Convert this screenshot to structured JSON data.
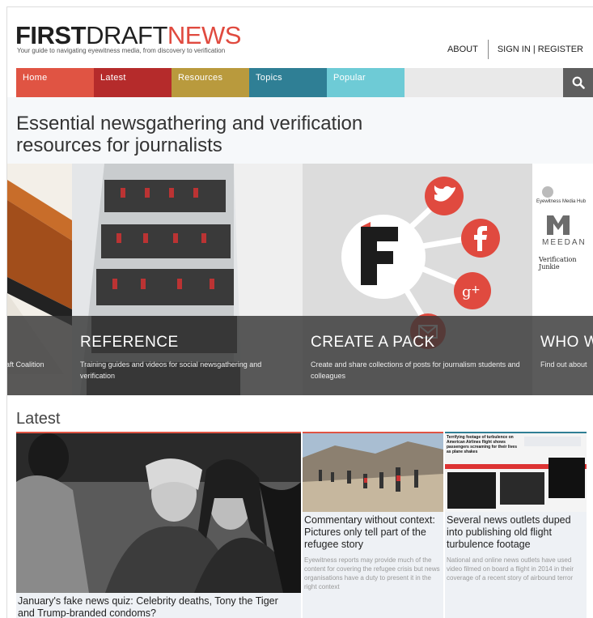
{
  "site": {
    "logo_part1": "FIRST",
    "logo_part2": "DRAFT",
    "logo_part3": "NEWS",
    "tagline": "Your guide to navigating eyewitness media, from discovery to verification"
  },
  "top_nav": {
    "about": "ABOUT",
    "signin": "SIGN IN | REGISTER"
  },
  "main_nav": {
    "items": [
      {
        "label": "Home",
        "color": "#e05443"
      },
      {
        "label": "Latest",
        "color": "#b52b2b"
      },
      {
        "label": "Resources",
        "color": "#b99a3d"
      },
      {
        "label": "Topics",
        "color": "#2f7f95"
      },
      {
        "label": "Popular",
        "color": "#6ecbd6"
      }
    ],
    "search_icon": "search-icon"
  },
  "hero": {
    "title_line1": "Essential newsgathering and verification",
    "title_line2": "resources for journalists"
  },
  "carousel": {
    "left_partial": {
      "title": "",
      "desc": "aft Coalition"
    },
    "slides": [
      {
        "title": "REFERENCE",
        "desc": "Training guides and videos for social newsgathering and verification"
      },
      {
        "title": "CREATE A PACK",
        "desc": "Create and share collections of posts for journalism students and colleagues"
      },
      {
        "title": "WHO W",
        "desc": "Find out about"
      }
    ],
    "partner_logos": [
      "Eyewitness Media Hub",
      "MEEDAN",
      "Verification Junkie"
    ],
    "social_icons": [
      "twitter-icon",
      "facebook-icon",
      "google-plus-icon",
      "mail-icon"
    ]
  },
  "latest": {
    "heading": "Latest",
    "cards": [
      {
        "title": "January's fake news quiz: Celebrity deaths, Tony the Tiger and Trump-branded condoms?",
        "desc": "",
        "border": "#e05443"
      },
      {
        "title": "Commentary without context: Pictures only tell part of the refugee story",
        "desc": "Eyewitness reports may provide much of the content for covering the refugee crisis but news organisations have a duty to present it in the right context",
        "border": "#e05443"
      },
      {
        "title": "Several news outlets duped into publishing old flight turbulence footage",
        "desc": "National and online news outlets have used video filmed on board a flight in 2014 in their coverage of a recent story of airbound terror",
        "border": "#2f7f95"
      }
    ],
    "screenshot_headline": "Terrifying footage of turbulence on American Airlines flight shows passengers screaming for their lives as plane shakes"
  }
}
